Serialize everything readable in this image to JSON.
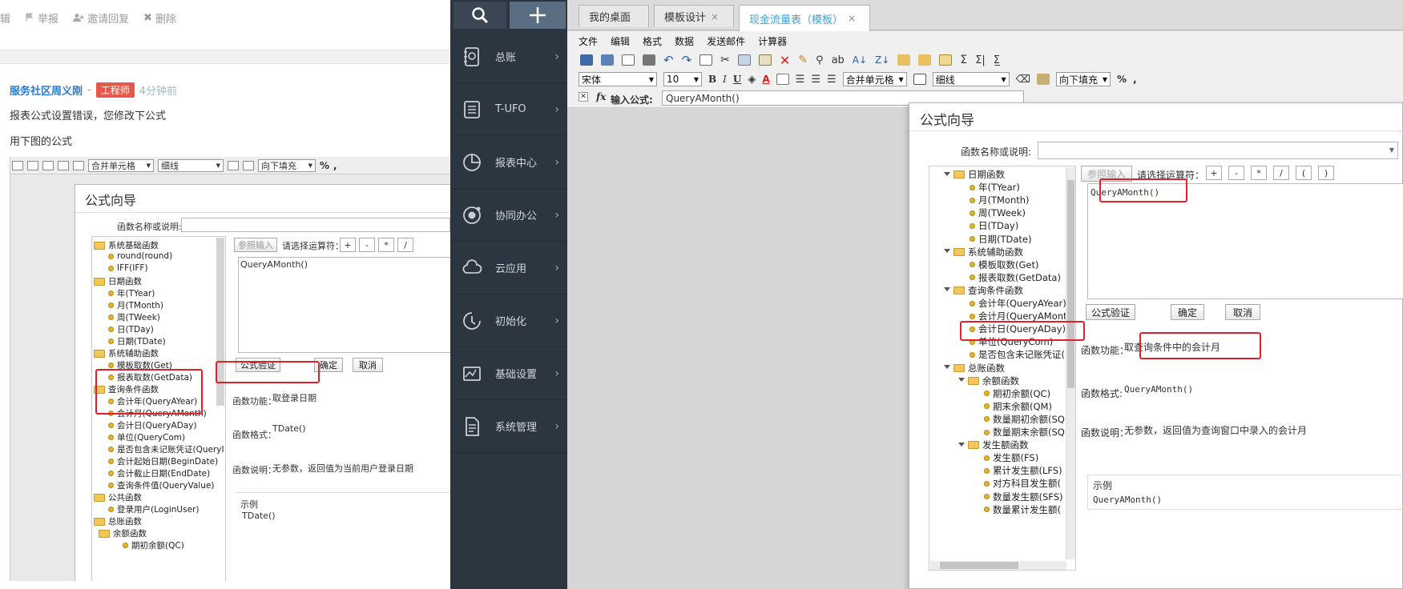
{
  "forum": {
    "actions": {
      "edit_partial": "辑",
      "report": "举报",
      "invite": "邀请回复",
      "delete": "删除"
    },
    "reply": {
      "author": "服务社区周义刚",
      "dash": "-",
      "badge": "工程师",
      "time": "4分钟前",
      "line1": "报表公式设置错误，您修改下公式",
      "line2": "用下图的公式"
    },
    "embedded": {
      "toolbar": {
        "merge": "合并单元格",
        "line": "细线",
        "fill": "向下填充",
        "percent": "%",
        "comma": ","
      },
      "dialog": {
        "title": "公式向导",
        "search_label": "函数名称或说明:",
        "ref_btn": "参照输入",
        "op_label": "请选择运算符：",
        "ops": [
          "+",
          "-",
          "*",
          "/"
        ],
        "formula": "QueryAMonth()",
        "validate": "公式验证",
        "ok": "确定",
        "cancel": "取消",
        "func_label": "函数功能：",
        "func_value": "取登录日期",
        "fmt_label": "函数格式：",
        "fmt_value": "TDate()",
        "desc_label": "函数说明：",
        "desc_value": "无参数，返回值为当前用户登录日期",
        "example_label": "示例",
        "example_value": "TDate()",
        "tree": [
          {
            "kind": "folder",
            "label": "系统基础函数"
          },
          {
            "kind": "leaf",
            "label": "round(round)"
          },
          {
            "kind": "leaf",
            "label": "IFF(IFF)"
          },
          {
            "kind": "folder",
            "label": "日期函数"
          },
          {
            "kind": "leaf",
            "label": "年(TYear)"
          },
          {
            "kind": "leaf",
            "label": "月(TMonth)"
          },
          {
            "kind": "leaf",
            "label": "周(TWeek)"
          },
          {
            "kind": "leaf",
            "label": "日(TDay)"
          },
          {
            "kind": "leaf",
            "label": "日期(TDate)"
          },
          {
            "kind": "folder",
            "label": "系统辅助函数"
          },
          {
            "kind": "leaf",
            "label": "模板取数(Get)"
          },
          {
            "kind": "leaf",
            "label": "报表取数(GetData)"
          },
          {
            "kind": "folder",
            "label": "查询条件函数"
          },
          {
            "kind": "leaf",
            "label": "会计年(QueryAYear)"
          },
          {
            "kind": "leaf",
            "label": "会计月(QueryAMonth)"
          },
          {
            "kind": "leaf",
            "label": "会计日(QueryADay)"
          },
          {
            "kind": "leaf",
            "label": "单位(QueryCom)"
          },
          {
            "kind": "leaf",
            "label": "是否包含未记账凭证(QueryI"
          },
          {
            "kind": "leaf",
            "label": "会计起始日期(BeginDate)"
          },
          {
            "kind": "leaf",
            "label": "会计截止日期(EndDate)"
          },
          {
            "kind": "leaf",
            "label": "查询条件值(QueryValue)"
          },
          {
            "kind": "folder",
            "label": "公共函数"
          },
          {
            "kind": "leaf",
            "label": "登录用户(LoginUser)"
          },
          {
            "kind": "folder",
            "label": "总账函数"
          },
          {
            "kind": "folder",
            "label": "余额函数"
          },
          {
            "kind": "leaf",
            "label": "期初余额(QC)"
          }
        ]
      }
    }
  },
  "nav": {
    "items": [
      {
        "label": "总账",
        "icon": "ledger-icon"
      },
      {
        "label": "T-UFO",
        "icon": "tufo-icon"
      },
      {
        "label": "报表中心",
        "icon": "pie-chart-icon"
      },
      {
        "label": "协同办公",
        "icon": "collab-icon"
      },
      {
        "label": "云应用",
        "icon": "cloud-icon"
      },
      {
        "label": "初始化",
        "icon": "init-icon"
      },
      {
        "label": "基础设置",
        "icon": "settings-chart-icon"
      },
      {
        "label": "系统管理",
        "icon": "system-doc-icon"
      }
    ],
    "arrow": "›"
  },
  "app": {
    "tabs": [
      {
        "label": "我的桌面",
        "close": ""
      },
      {
        "label": "模板设计",
        "close": "×"
      },
      {
        "label": "现金流量表（模板）",
        "close": "×"
      }
    ],
    "menu": [
      "文件",
      "编辑",
      "格式",
      "数据",
      "发送邮件",
      "计算器"
    ],
    "toolbar": {
      "font": "宋体",
      "size": "10",
      "bold": "B",
      "italic": "I",
      "underline": "U",
      "fontcolor": "A",
      "merge": "合并单元格",
      "line": "细线",
      "fill": "向下填充",
      "percent": "%",
      "comma": ","
    },
    "formula_bar": {
      "fx": "fx",
      "label": "输入公式:",
      "value": "QueryAMonth()"
    },
    "dialog": {
      "title": "公式向导",
      "search_label": "函数名称或说明:",
      "search_value": "",
      "ref_btn": "参照输入",
      "op_label": "请选择运算符：",
      "ops": [
        "+",
        "-",
        "*",
        "/",
        "(",
        ")"
      ],
      "formula": "QueryAMonth()",
      "validate": "公式验证",
      "ok": "确定",
      "cancel": "取消",
      "func_label": "函数功能：",
      "func_value": "取查询条件中的会计月",
      "fmt_label": "函数格式:",
      "fmt_value": "QueryAMonth()",
      "desc_label": "函数说明：",
      "desc_value": "无参数，返回值为查询窗口中录入的会计月",
      "example_label": "示例",
      "example_value": "QueryAMonth()",
      "tree": [
        {
          "kind": "folder",
          "label": "日期函数",
          "depth": 1
        },
        {
          "kind": "leaf",
          "label": "年(TYear)",
          "depth": 2
        },
        {
          "kind": "leaf",
          "label": "月(TMonth)",
          "depth": 2
        },
        {
          "kind": "leaf",
          "label": "周(TWeek)",
          "depth": 2
        },
        {
          "kind": "leaf",
          "label": "日(TDay)",
          "depth": 2
        },
        {
          "kind": "leaf",
          "label": "日期(TDate)",
          "depth": 2
        },
        {
          "kind": "folder",
          "label": "系统辅助函数",
          "depth": 1
        },
        {
          "kind": "leaf",
          "label": "模板取数(Get)",
          "depth": 2
        },
        {
          "kind": "leaf",
          "label": "报表取数(GetData)",
          "depth": 2
        },
        {
          "kind": "folder",
          "label": "查询条件函数",
          "depth": 1
        },
        {
          "kind": "leaf",
          "label": "会计年(QueryAYear)",
          "depth": 2
        },
        {
          "kind": "leaf",
          "label": "会计月(QueryAMonth",
          "depth": 2
        },
        {
          "kind": "leaf",
          "label": "会计日(QueryADay)",
          "depth": 2
        },
        {
          "kind": "leaf",
          "label": "单位(QueryCom)",
          "depth": 2
        },
        {
          "kind": "leaf",
          "label": "是否包含未记账凭证(",
          "depth": 2
        },
        {
          "kind": "folder",
          "label": "总账函数",
          "depth": 1
        },
        {
          "kind": "folder",
          "label": "余额函数",
          "depth": 2
        },
        {
          "kind": "leaf",
          "label": "期初余额(QC)",
          "depth": 3
        },
        {
          "kind": "leaf",
          "label": "期末余额(QM)",
          "depth": 3
        },
        {
          "kind": "leaf",
          "label": "数量期初余额(SQ",
          "depth": 3
        },
        {
          "kind": "leaf",
          "label": "数量期末余额(SQ",
          "depth": 3
        },
        {
          "kind": "folder",
          "label": "发生额函数",
          "depth": 2
        },
        {
          "kind": "leaf",
          "label": "发生额(FS)",
          "depth": 3
        },
        {
          "kind": "leaf",
          "label": "累计发生额(LFS)",
          "depth": 3
        },
        {
          "kind": "leaf",
          "label": "对方科目发生额(",
          "depth": 3
        },
        {
          "kind": "leaf",
          "label": "数量发生额(SFS)",
          "depth": 3
        },
        {
          "kind": "leaf",
          "label": "数量累计发生额(",
          "depth": 3
        }
      ]
    }
  },
  "colors": {
    "highlight_red": "#e0202a",
    "sidebar_bg": "#2c3641",
    "active_tab_text": "#3aa2d4",
    "author_blue": "#2b7bd6",
    "badge_red": "#e8574a"
  }
}
